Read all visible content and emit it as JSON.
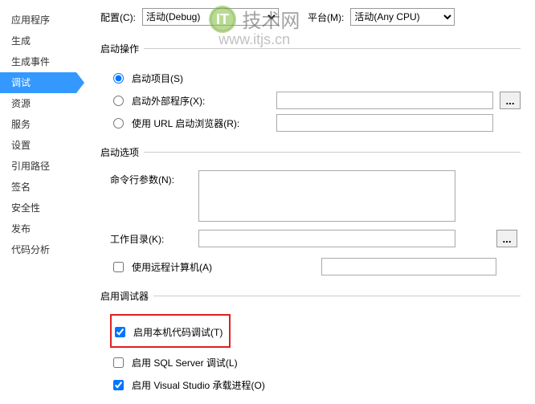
{
  "watermark": {
    "logo": "IT",
    "text": "技术网",
    "url": "www.itjs.cn"
  },
  "sidebar": {
    "items": [
      {
        "label": "应用程序"
      },
      {
        "label": "生成"
      },
      {
        "label": "生成事件"
      },
      {
        "label": "调试",
        "active": true
      },
      {
        "label": "资源"
      },
      {
        "label": "服务"
      },
      {
        "label": "设置"
      },
      {
        "label": "引用路径"
      },
      {
        "label": "签名"
      },
      {
        "label": "安全性"
      },
      {
        "label": "发布"
      },
      {
        "label": "代码分析"
      }
    ]
  },
  "top": {
    "config_label": "配置(C):",
    "config_value": "活动(Debug)",
    "platform_label": "平台(M):",
    "platform_value": "活动(Any CPU)"
  },
  "start_action": {
    "legend": "启动操作",
    "opt_project": "启动项目(S)",
    "opt_external": "启动外部程序(X):",
    "opt_url": "使用 URL 启动浏览器(R):",
    "browse": "...",
    "selected": "project"
  },
  "start_options": {
    "legend": "启动选项",
    "args_label": "命令行参数(N):",
    "args_value": "",
    "workdir_label": "工作目录(K):",
    "workdir_value": "",
    "browse": "...",
    "remote_label": "使用远程计算机(A)",
    "remote_checked": false
  },
  "debuggers": {
    "legend": "启用调试器",
    "native_label": "启用本机代码调试(T)",
    "native_checked": true,
    "sql_label": "启用 SQL Server 调试(L)",
    "sql_checked": false,
    "vshost_label": "启用 Visual Studio 承载进程(O)",
    "vshost_checked": true
  }
}
